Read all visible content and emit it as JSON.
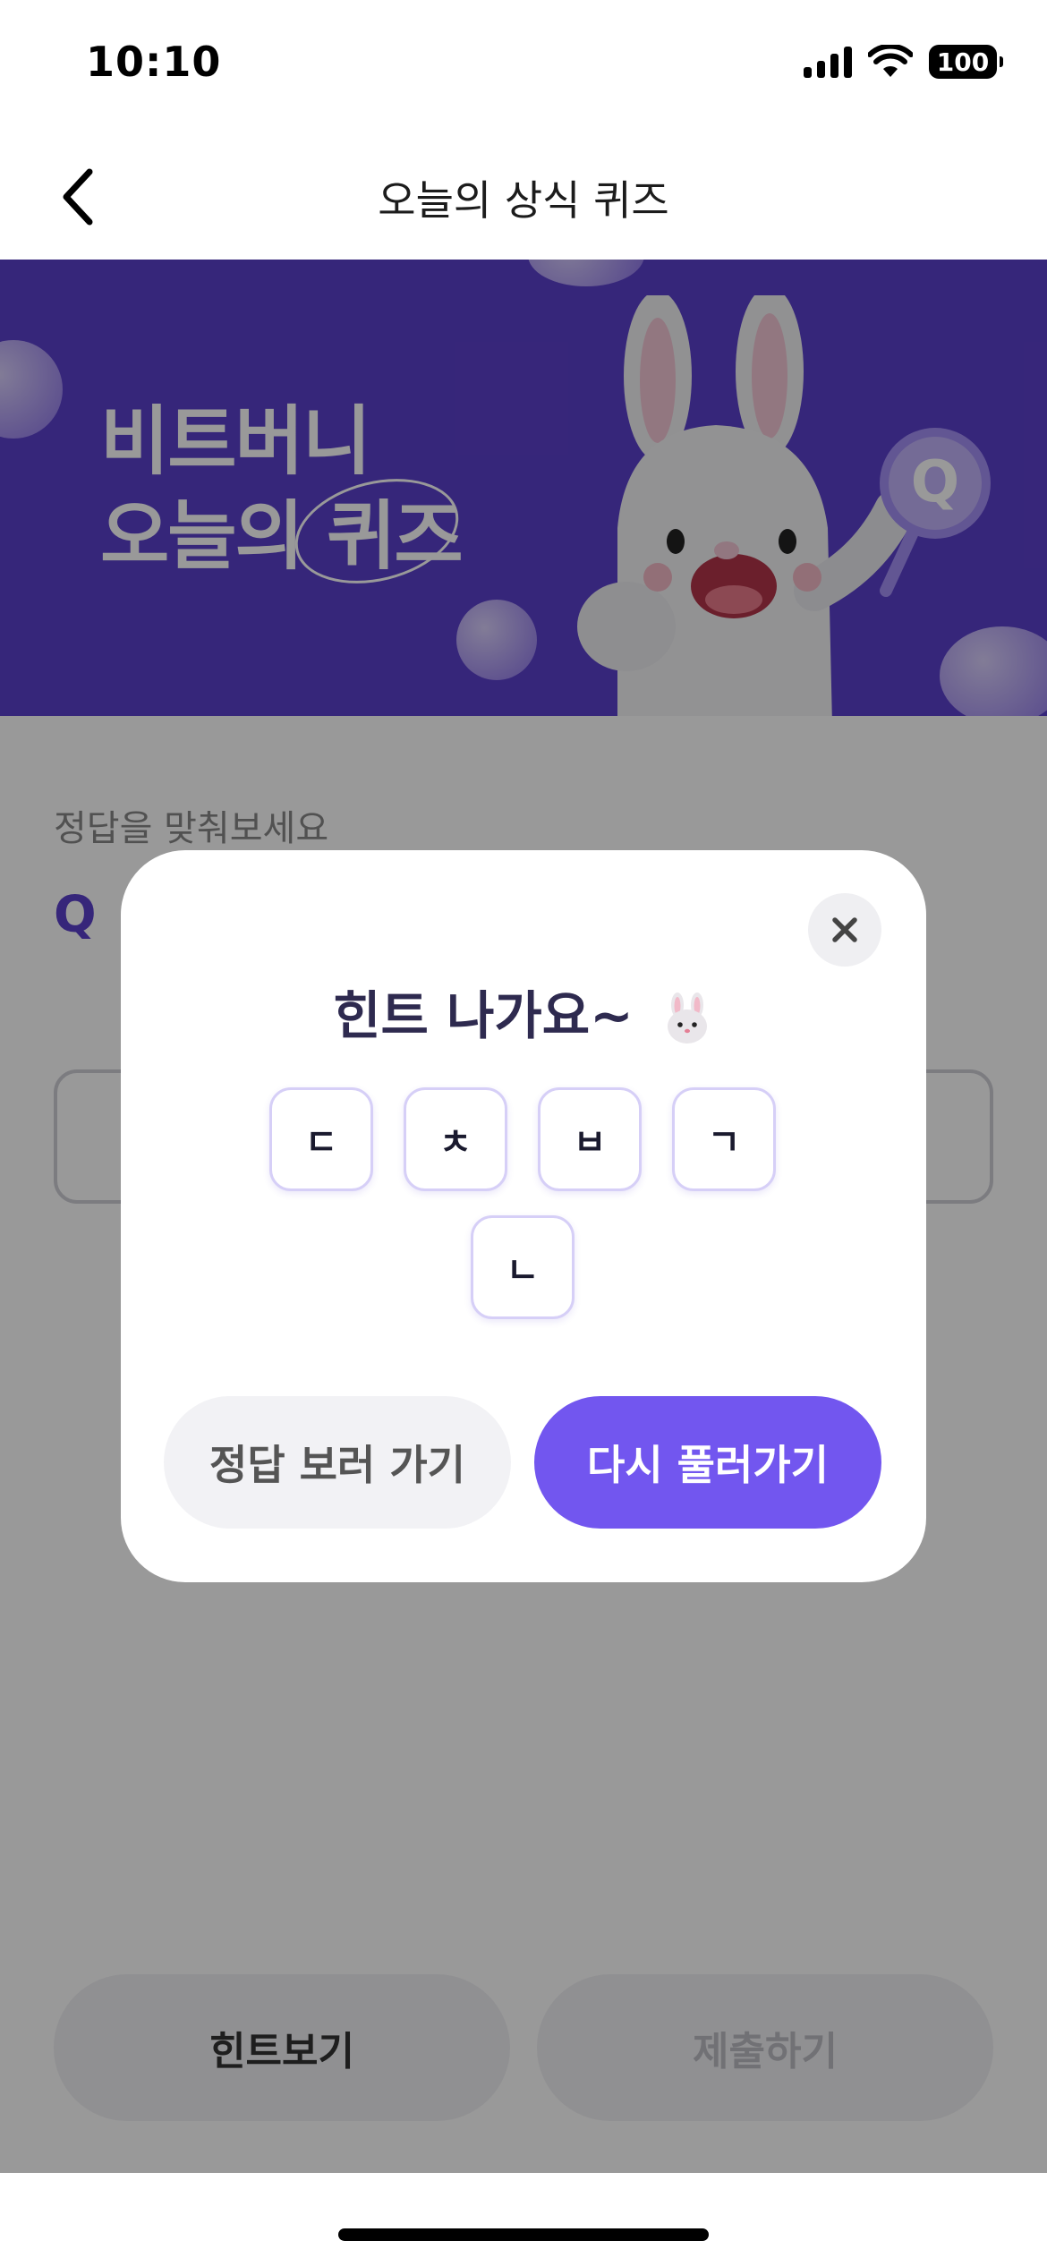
{
  "status": {
    "time": "10:10",
    "battery": "100"
  },
  "nav": {
    "title": "오늘의 상식 퀴즈"
  },
  "banner": {
    "line1": "비트버니",
    "line2": "오늘의 퀴즈"
  },
  "quiz": {
    "prompt": "정답을 맞춰보세요",
    "q_label": "Q"
  },
  "bottom_buttons": {
    "hint": "힌트보기",
    "submit": "제출하기"
  },
  "modal": {
    "title": "힌트 나가요~",
    "tiles": [
      "ㄷ",
      "ㅊ",
      "ㅂ",
      "ㄱ",
      "ㄴ"
    ],
    "answer_button": "정답 보러 가기",
    "retry_button": "다시 풀러가기"
  },
  "colors": {
    "brand": "#5b40cc",
    "primary_button": "#7256ef"
  },
  "icons": [
    "back-chevron-icon",
    "close-icon",
    "bunny-emoji-icon",
    "signal-icon",
    "wifi-icon",
    "battery-icon"
  ]
}
